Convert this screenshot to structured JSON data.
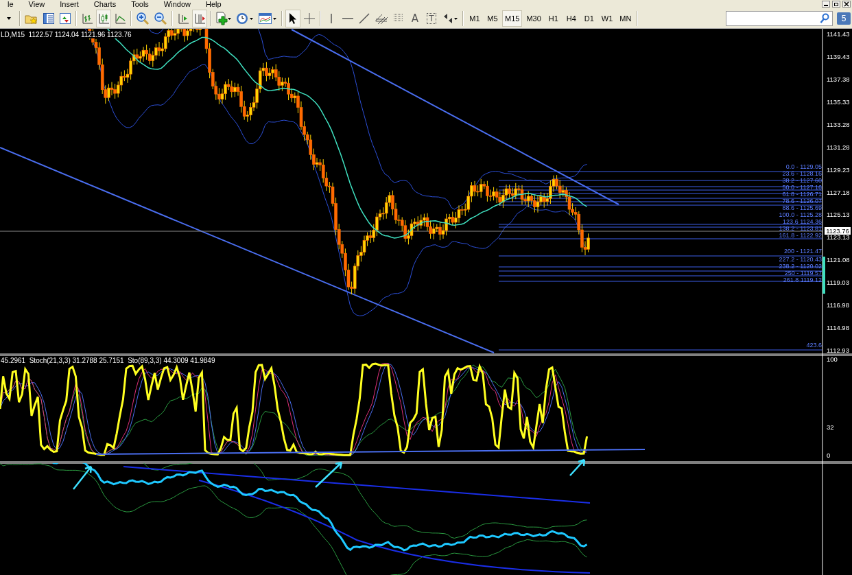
{
  "menu": [
    "le",
    "View",
    "Insert",
    "Charts",
    "Tools",
    "Window",
    "Help"
  ],
  "toolbar": [
    {
      "kind": "dropdown",
      "selected": false
    },
    {
      "kind": "favorites",
      "selected": false
    },
    {
      "kind": "navigator",
      "selected": false
    },
    {
      "kind": "data-window",
      "selected": false
    },
    {
      "kind": "bar-chart",
      "selected": false
    },
    {
      "kind": "candles",
      "selected": true
    },
    {
      "kind": "line-chart",
      "selected": false
    },
    {
      "kind": "zoom-in",
      "selected": false
    },
    {
      "kind": "zoom-out",
      "selected": false
    },
    {
      "kind": "chart-shift",
      "selected": false
    },
    {
      "kind": "autoscroll",
      "selected": true
    },
    {
      "kind": "new-indicator",
      "selected": false
    },
    {
      "kind": "periods",
      "selected": false
    },
    {
      "kind": "templates",
      "selected": false
    },
    {
      "kind": "cursor",
      "selected": true
    },
    {
      "kind": "crosshair",
      "selected": false
    },
    {
      "kind": "vertical-line",
      "selected": false
    },
    {
      "kind": "horizontal-line",
      "selected": false
    },
    {
      "kind": "trendline",
      "selected": false
    },
    {
      "kind": "channel",
      "selected": false
    },
    {
      "kind": "fibonacci",
      "selected": false
    },
    {
      "kind": "text",
      "label": "A",
      "selected": false
    },
    {
      "kind": "text-label",
      "label": "T",
      "selected": false
    },
    {
      "kind": "arrows",
      "selected": false
    }
  ],
  "timeframes": [
    {
      "label": "M1",
      "selected": false
    },
    {
      "label": "M5",
      "selected": false
    },
    {
      "label": "M15",
      "selected": true
    },
    {
      "label": "M30",
      "selected": false
    },
    {
      "label": "H1",
      "selected": false
    },
    {
      "label": "H4",
      "selected": false
    },
    {
      "label": "D1",
      "selected": false
    },
    {
      "label": "W1",
      "selected": false
    },
    {
      "label": "MN",
      "selected": false
    }
  ],
  "notification_badge": "5",
  "chart": {
    "header": "LD,M15  1122.57 1124.04 1121.96 1123.76",
    "price_axis": [
      "1141.43",
      "1139.43",
      "1137.38",
      "1135.33",
      "1133.28",
      "1131.28",
      "1129.23",
      "1127.18",
      "1125.13",
      "1123.13",
      "1121.08",
      "1119.03",
      "1116.98",
      "1114.98",
      "1112.93"
    ],
    "current_price": "1123.76",
    "fibonacci_levels": [
      "0.0 - 1129.05",
      "23.6 - 1128.16",
      "38.2 - 1127.60",
      "50.0 - 1127.16",
      "61.8 - 1126.71",
      "78.6 - 1126.07",
      "88.6 - 1125.69",
      "100.0 - 1125.28",
      "123.6 1124.36",
      "138.2 - 1123.81",
      "161.8 - 1122.92",
      "200 - 1121.47",
      "227.2 - 1120.43",
      "238.2 - 1120.02",
      "250 - 1119.57",
      "261.8 1119.12",
      "423.6"
    ]
  },
  "stochastic": {
    "header": "45.2961  Stoch(21,3,3) 31.2788 25.7151  Sto(89,3,3) 44.3009 41.9849",
    "axis": [
      "100",
      "32",
      "0"
    ]
  }
}
